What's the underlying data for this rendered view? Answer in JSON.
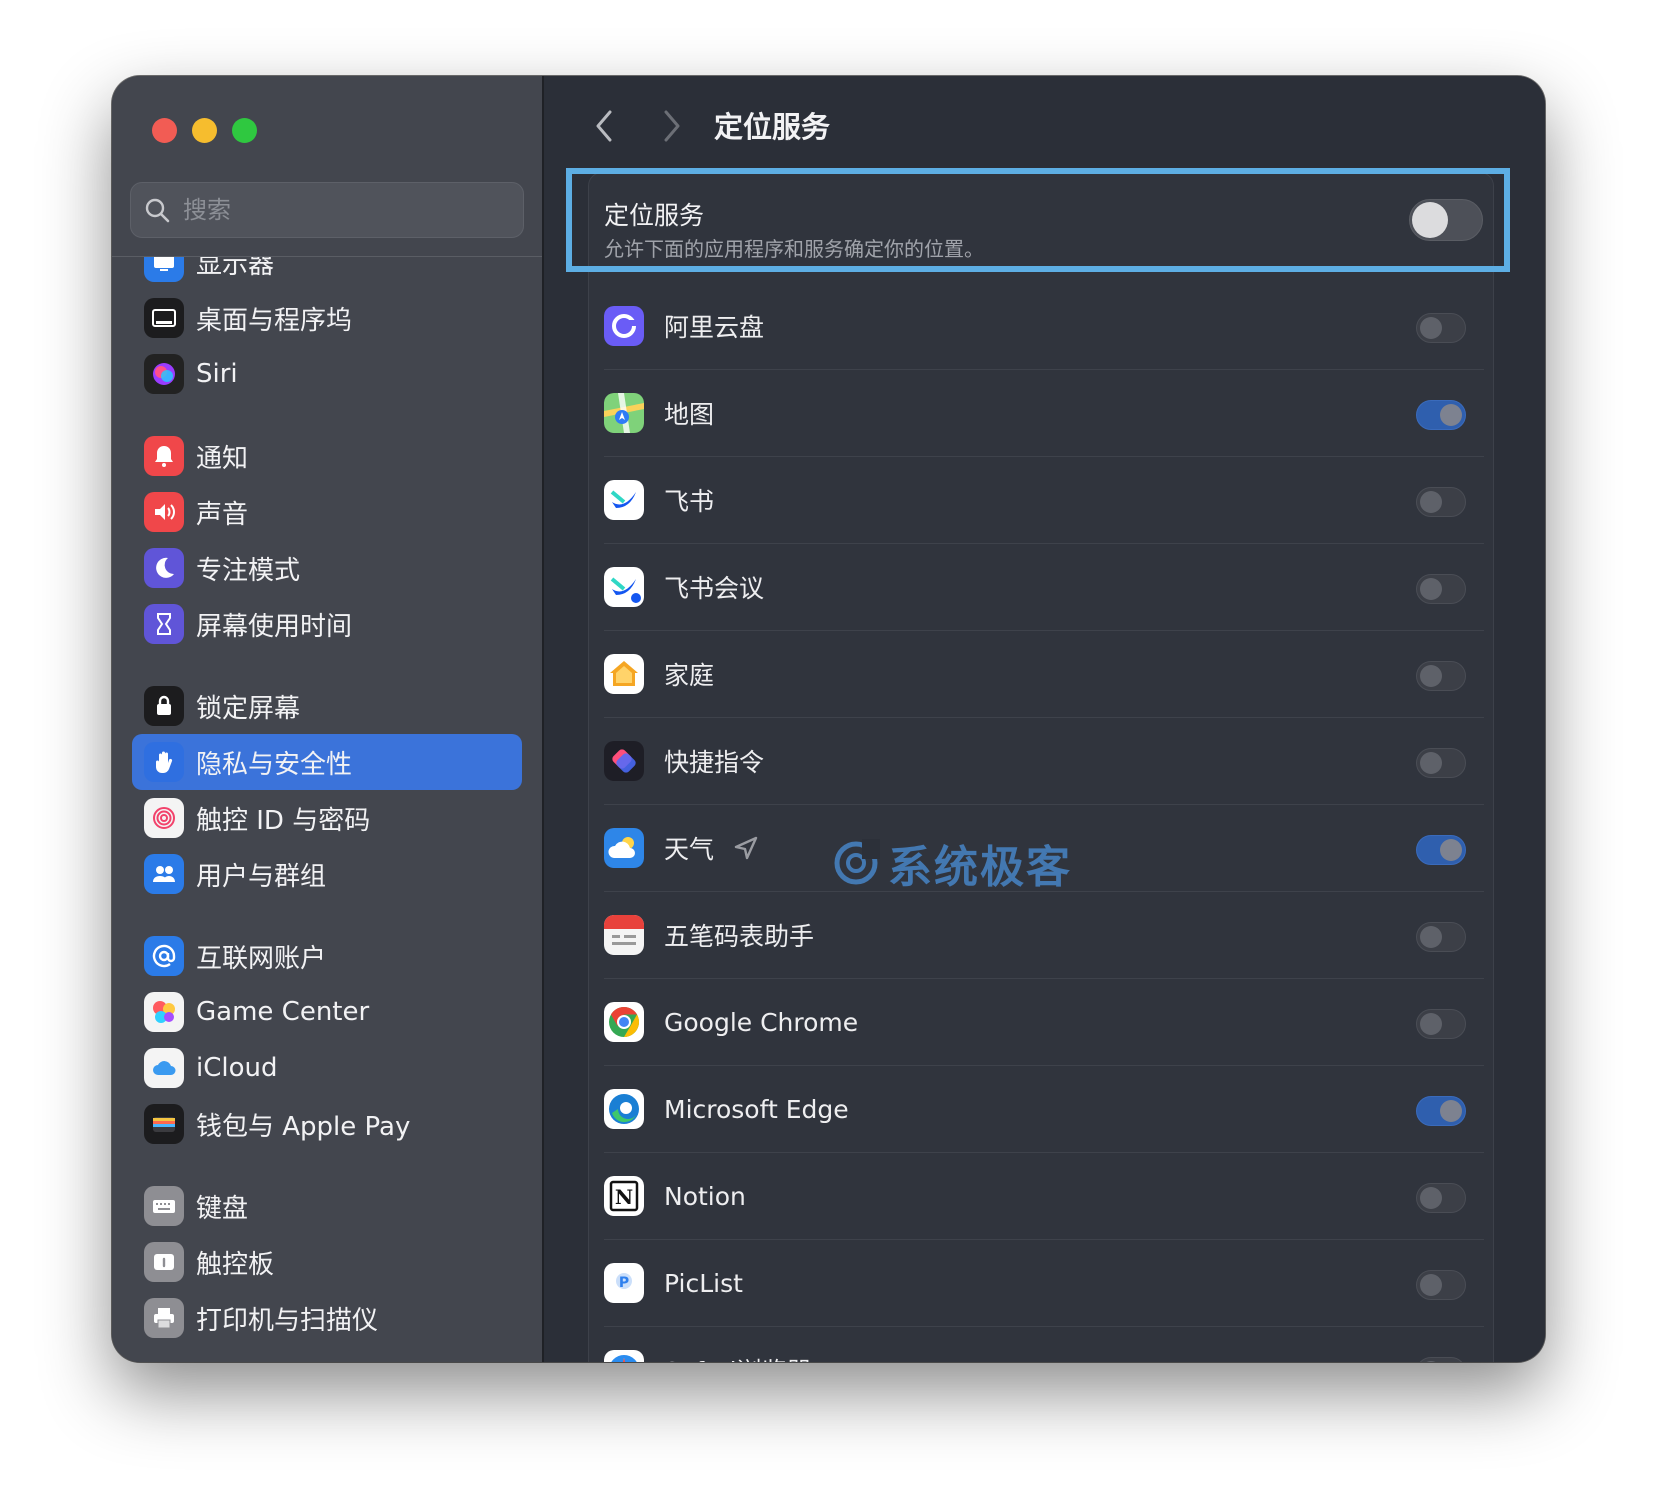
{
  "sidebar": {
    "search_placeholder": "搜索",
    "groups": [
      [
        {
          "label": "显示器",
          "icon": "display-icon",
          "color": "#2b7be8"
        },
        {
          "label": "桌面与程序坞",
          "icon": "dock-icon",
          "color": "#1c1c1e"
        },
        {
          "label": "Siri",
          "icon": "siri-icon",
          "color": "#222"
        }
      ],
      [
        {
          "label": "通知",
          "icon": "bell-icon",
          "color": "#f0474a"
        },
        {
          "label": "声音",
          "icon": "speaker-icon",
          "color": "#f0474a"
        },
        {
          "label": "专注模式",
          "icon": "moon-icon",
          "color": "#6055d8"
        },
        {
          "label": "屏幕使用时间",
          "icon": "hourglass-icon",
          "color": "#6055d8"
        }
      ],
      [
        {
          "label": "锁定屏幕",
          "icon": "lock-icon",
          "color": "#1c1c1e"
        },
        {
          "label": "隐私与安全性",
          "icon": "hand-icon",
          "color": "#2f6fe0",
          "active": true
        },
        {
          "label": "触控 ID 与密码",
          "icon": "fingerprint-icon",
          "color": "#f4f4f4"
        },
        {
          "label": "用户与群组",
          "icon": "users-icon",
          "color": "#2b7be8"
        }
      ],
      [
        {
          "label": "互联网账户",
          "icon": "at-icon",
          "color": "#2b7be8"
        },
        {
          "label": "Game Center",
          "icon": "game-center-icon",
          "color": "#f4f4f4"
        },
        {
          "label": "iCloud",
          "icon": "cloud-icon",
          "color": "#f4f4f4"
        },
        {
          "label": "钱包与 Apple Pay",
          "icon": "wallet-icon",
          "color": "#1c1c1e"
        }
      ],
      [
        {
          "label": "键盘",
          "icon": "keyboard-icon",
          "color": "#8e8e93"
        },
        {
          "label": "触控板",
          "icon": "trackpad-icon",
          "color": "#8e8e93"
        },
        {
          "label": "打印机与扫描仪",
          "icon": "printer-icon",
          "color": "#8e8e93"
        }
      ]
    ]
  },
  "main": {
    "title": "定位服务",
    "location_services": {
      "title": "定位服务",
      "description": "允许下面的应用程序和服务确定你的位置。",
      "enabled": false
    },
    "apps": [
      {
        "name": "阿里云盘",
        "icon": "aliyun-drive-icon",
        "enabled": false
      },
      {
        "name": "地图",
        "icon": "maps-icon",
        "enabled": true
      },
      {
        "name": "飞书",
        "icon": "feishu-icon",
        "enabled": false
      },
      {
        "name": "飞书会议",
        "icon": "feishu-meeting-icon",
        "enabled": false
      },
      {
        "name": "家庭",
        "icon": "home-icon",
        "enabled": false
      },
      {
        "name": "快捷指令",
        "icon": "shortcuts-icon",
        "enabled": false
      },
      {
        "name": "天气",
        "icon": "weather-icon",
        "enabled": true,
        "recent_use": true
      },
      {
        "name": "五笔码表助手",
        "icon": "wubi-icon",
        "enabled": false
      },
      {
        "name": "Google Chrome",
        "icon": "chrome-icon",
        "enabled": false
      },
      {
        "name": "Microsoft Edge",
        "icon": "edge-icon",
        "enabled": true
      },
      {
        "name": "Notion",
        "icon": "notion-icon",
        "enabled": false
      },
      {
        "name": "PicList",
        "icon": "piclist-icon",
        "enabled": false
      },
      {
        "name": "Safari浏览器",
        "icon": "safari-icon",
        "enabled": false
      }
    ]
  },
  "watermark": "系统极客",
  "colors": {
    "accent": "#3b73da",
    "highlight": "#5daee4",
    "toggle_on": "#2f5fae"
  }
}
